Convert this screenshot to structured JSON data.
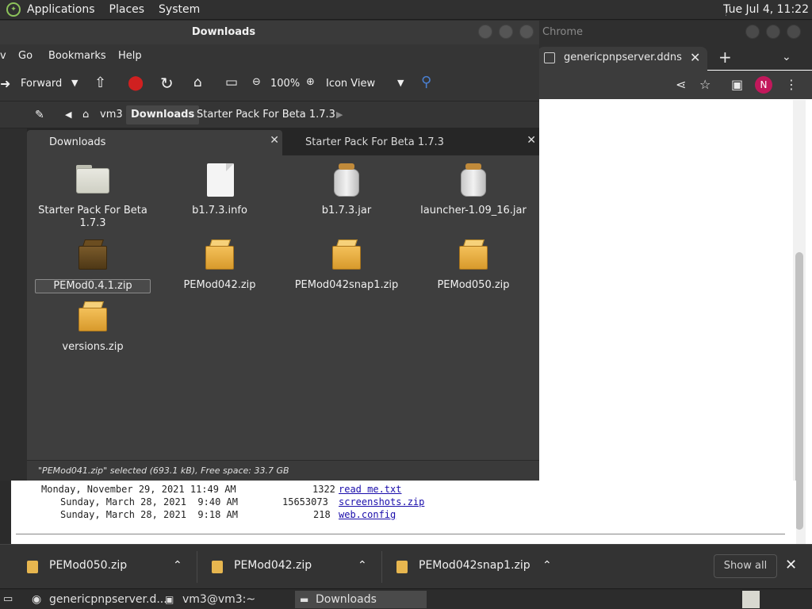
{
  "top_panel": {
    "menus": [
      "Applications",
      "Places",
      "System"
    ],
    "clock": "Tue Jul  4, 11:22"
  },
  "chrome": {
    "window_title": "Chrome",
    "tab_title": "genericpnpserver.ddns.net",
    "avatar_letter": "N",
    "listing": [
      {
        "date": "Monday, November 29, 2021 11:49 AM",
        "size": "1322",
        "name": "read me.txt"
      },
      {
        "date": "Sunday, March 28, 2021  9:40 AM",
        "size": "15653073",
        "name": "screenshots.zip"
      },
      {
        "date": "Sunday, March 28, 2021  9:18 AM",
        "size": "218",
        "name": "web.config"
      }
    ]
  },
  "nautilus": {
    "title": "Downloads",
    "menus": [
      "Go",
      "Bookmarks",
      "Help"
    ],
    "toolbar": {
      "forward": "Forward",
      "zoom": "100%",
      "view_mode": "Icon View"
    },
    "breadcrumbs": [
      "vm3",
      "Downloads",
      "Starter Pack For Beta 1.7.3"
    ],
    "tabs": [
      "Downloads",
      "Starter Pack For Beta 1.7.3"
    ],
    "files": [
      {
        "name": "Starter Pack For Beta 1.7.3",
        "icon": "folder-icon"
      },
      {
        "name": "b1.7.3.info",
        "icon": "document-icon"
      },
      {
        "name": "b1.7.3.jar",
        "icon": "jar-icon"
      },
      {
        "name": "launcher-1.09_16.jar",
        "icon": "jar-icon"
      },
      {
        "name": "PEMod0.4.1.zip",
        "icon": "zip-icon"
      },
      {
        "name": "PEMod042.zip",
        "icon": "zip-icon"
      },
      {
        "name": "PEMod042snap1.zip",
        "icon": "zip-icon"
      },
      {
        "name": "PEMod050.zip",
        "icon": "zip-icon"
      },
      {
        "name": "versions.zip",
        "icon": "zip-icon"
      }
    ],
    "status": "\"PEMod041.zip\" selected (693.1 kB), Free space: 33.7 GB"
  },
  "shelf": {
    "downloads": [
      "PEMod050.zip",
      "PEMod042.zip",
      "PEMod042snap1.zip"
    ],
    "show_all": "Show all"
  },
  "taskbar": {
    "tasks": [
      "genericpnpserver.d...",
      "vm3@vm3:~",
      "Downloads"
    ]
  }
}
